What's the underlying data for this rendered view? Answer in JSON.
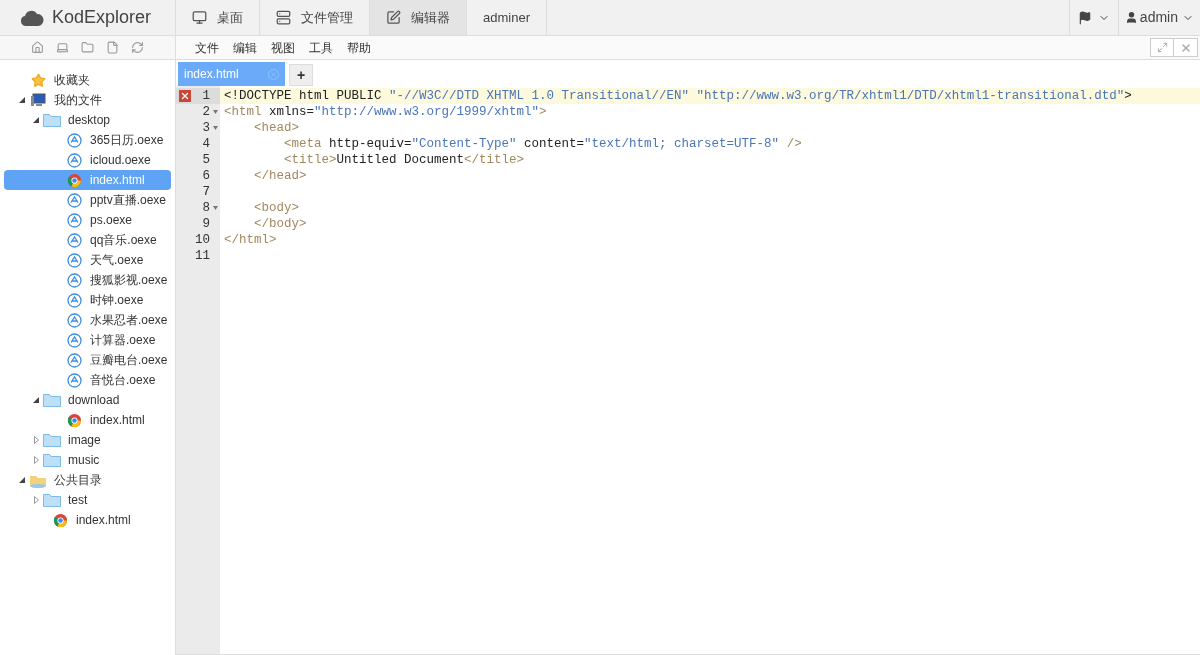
{
  "brand": "KodExplorer",
  "nav": [
    {
      "label": "桌面",
      "selected": false
    },
    {
      "label": "文件管理",
      "selected": false
    },
    {
      "label": "编辑器",
      "selected": true
    },
    {
      "label": "adminer",
      "selected": false
    }
  ],
  "user": {
    "name": "admin"
  },
  "menu": [
    "文件",
    "编辑",
    "视图",
    "工具",
    "帮助"
  ],
  "tree": [
    {
      "label": "收藏夹",
      "kind": "star",
      "selected": false
    },
    {
      "label": "我的文件",
      "kind": "computer",
      "expanded": true,
      "selected": false,
      "children": [
        {
          "label": "desktop",
          "kind": "folder",
          "expanded": true,
          "selected": false,
          "children": [
            {
              "label": "365日历.oexe",
              "kind": "app",
              "selected": false
            },
            {
              "label": "icloud.oexe",
              "kind": "app",
              "selected": false
            },
            {
              "label": "index.html",
              "kind": "html",
              "selected": true
            },
            {
              "label": "pptv直播.oexe",
              "kind": "app",
              "selected": false
            },
            {
              "label": "ps.oexe",
              "kind": "app",
              "selected": false
            },
            {
              "label": "qq音乐.oexe",
              "kind": "app",
              "selected": false
            },
            {
              "label": "天气.oexe",
              "kind": "app",
              "selected": false
            },
            {
              "label": "搜狐影视.oexe",
              "kind": "app",
              "selected": false
            },
            {
              "label": "时钟.oexe",
              "kind": "app",
              "selected": false
            },
            {
              "label": "水果忍者.oexe",
              "kind": "app",
              "selected": false
            },
            {
              "label": "计算器.oexe",
              "kind": "app",
              "selected": false
            },
            {
              "label": "豆瓣电台.oexe",
              "kind": "app",
              "selected": false
            },
            {
              "label": "音悦台.oexe",
              "kind": "app",
              "selected": false
            }
          ]
        },
        {
          "label": "download",
          "kind": "folder",
          "expanded": true,
          "selected": false,
          "children": [
            {
              "label": "index.html",
              "kind": "html",
              "selected": false
            }
          ]
        },
        {
          "label": "image",
          "kind": "folder",
          "expanded": false,
          "selected": false
        },
        {
          "label": "music",
          "kind": "folder",
          "expanded": false,
          "selected": false
        }
      ]
    },
    {
      "label": "公共目录",
      "kind": "share",
      "expanded": true,
      "selected": false,
      "children": [
        {
          "label": "test",
          "kind": "folder",
          "expanded": false,
          "selected": false
        },
        {
          "label": "index.html",
          "kind": "html",
          "selected": false
        }
      ]
    }
  ],
  "tabs": [
    {
      "label": "index.html",
      "selected": true
    }
  ],
  "new_tab": "+",
  "editor": {
    "lines": [
      {
        "num": "1",
        "fold": false,
        "error": true,
        "active": true,
        "tokens": [
          {
            "kind": "text",
            "t": "<!DOCTYPE html PUBLIC "
          },
          {
            "kind": "string",
            "t": "\"-//W3C//DTD XHTML 1.0 Transitional//EN\""
          },
          {
            "kind": "string",
            "t": " \"http://www.w3.org/TR/xhtml1/DTD/xhtml1-transitional.dtd\""
          },
          {
            "kind": "text",
            "t": ">"
          }
        ]
      },
      {
        "num": "2",
        "fold": true,
        "error": false,
        "active": false,
        "tokens": [
          {
            "kind": "tag",
            "t": "<html"
          },
          {
            "kind": "text",
            "t": " xmlns="
          },
          {
            "kind": "string",
            "t": "\"http://www.w3.org/1999/xhtml\""
          },
          {
            "kind": "tag",
            "t": ">"
          }
        ]
      },
      {
        "num": "3",
        "fold": true,
        "error": false,
        "active": false,
        "tokens": [
          {
            "kind": "tag",
            "t": "    <head>"
          }
        ]
      },
      {
        "num": "4",
        "fold": false,
        "error": false,
        "active": false,
        "tokens": [
          {
            "kind": "tag",
            "t": "        <meta"
          },
          {
            "kind": "text",
            "t": " http-equiv="
          },
          {
            "kind": "string",
            "t": "\"Content-Type\""
          },
          {
            "kind": "text",
            "t": " content="
          },
          {
            "kind": "string",
            "t": "\"text/html; charset=UTF-8\""
          },
          {
            "kind": "tag",
            "t": " />"
          }
        ]
      },
      {
        "num": "5",
        "fold": false,
        "error": false,
        "active": false,
        "tokens": [
          {
            "kind": "tag",
            "t": "        <title>"
          },
          {
            "kind": "text",
            "t": "Untitled Document"
          },
          {
            "kind": "tag",
            "t": "</title>"
          }
        ]
      },
      {
        "num": "6",
        "fold": false,
        "error": false,
        "active": false,
        "tokens": [
          {
            "kind": "tag",
            "t": "    </head>"
          }
        ]
      },
      {
        "num": "7",
        "fold": false,
        "error": false,
        "active": false
      },
      {
        "num": "8",
        "fold": true,
        "error": false,
        "active": false,
        "tokens": [
          {
            "kind": "tag",
            "t": "    <body>"
          }
        ]
      },
      {
        "num": "9",
        "fold": false,
        "error": false,
        "active": false,
        "tokens": [
          {
            "kind": "tag",
            "t": "    </body>"
          }
        ]
      },
      {
        "num": "10",
        "fold": false,
        "error": false,
        "active": false,
        "tokens": [
          {
            "kind": "tag",
            "t": "</html>"
          }
        ]
      },
      {
        "num": "11",
        "fold": false,
        "error": false,
        "active": false
      }
    ]
  }
}
